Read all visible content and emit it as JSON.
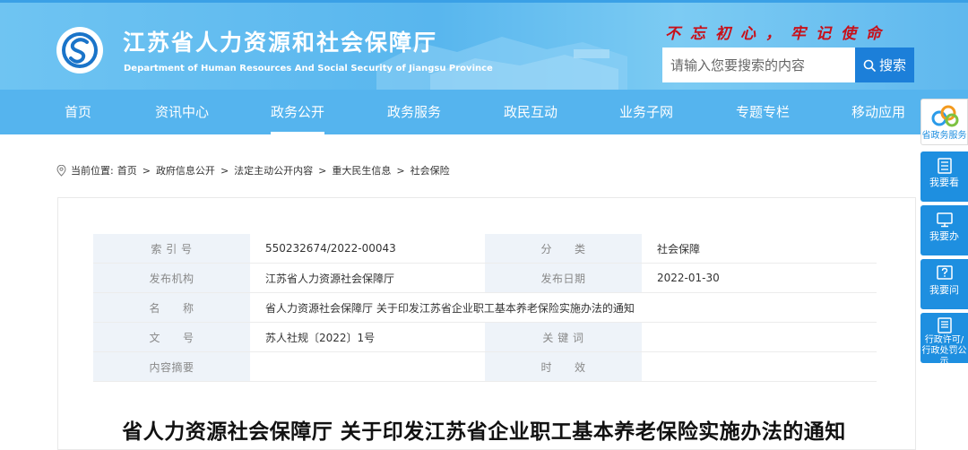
{
  "header": {
    "title": "江苏省人力资源和社会保障厅",
    "subtitle": "Department of Human Resources And Social Security of Jiangsu Province",
    "slogan": "不忘初心，牢记使命",
    "search_placeholder": "请输入您要搜索的内容",
    "search_button": "搜索"
  },
  "nav": [
    {
      "label": "首页"
    },
    {
      "label": "资讯中心"
    },
    {
      "label": "政务公开",
      "active": true
    },
    {
      "label": "政务服务"
    },
    {
      "label": "政民互动"
    },
    {
      "label": "业务子网"
    },
    {
      "label": "专题专栏"
    },
    {
      "label": "移动应用"
    }
  ],
  "breadcrumb": {
    "prefix": "当前位置:",
    "items": [
      "首页",
      "政府信息公开",
      "法定主动公开内容",
      "重大民生信息",
      "社会保险"
    ]
  },
  "info": {
    "index_label": "索 引 号",
    "index_value": "550232674/2022-00043",
    "category_label": "分　　类",
    "category_value": "社会保障",
    "issuer_label": "发布机构",
    "issuer_value": "江苏省人力资源社会保障厅",
    "date_label": "发布日期",
    "date_value": "2022-01-30",
    "name_label": "名　　称",
    "name_value": "省人力资源社会保障厅 关于印发江苏省企业职工基本养老保险实施办法的通知",
    "doc_no_label": "文　　号",
    "doc_no_value": "苏人社规〔2022〕1号",
    "keywords_label": "关 键 词",
    "keywords_value": "",
    "summary_label": "内容摘要",
    "summary_value": "",
    "validity_label": "时　　效",
    "validity_value": ""
  },
  "article": {
    "title": "省人力资源社会保障厅 关于印发江苏省企业职工基本养老保险实施办法的通知"
  },
  "sidebar": [
    {
      "label": "省政务服务"
    },
    {
      "label": "我要看"
    },
    {
      "label": "我要办"
    },
    {
      "label": "我要问"
    },
    {
      "label": "行政许可/行政处罚公示"
    }
  ],
  "colors": {
    "header_bg": "#5fb8ee",
    "nav_bg": "#55b4ee",
    "slogan": "#c8101a",
    "search_button": "#1c7fd9",
    "side_button": "#1e8fe0"
  }
}
